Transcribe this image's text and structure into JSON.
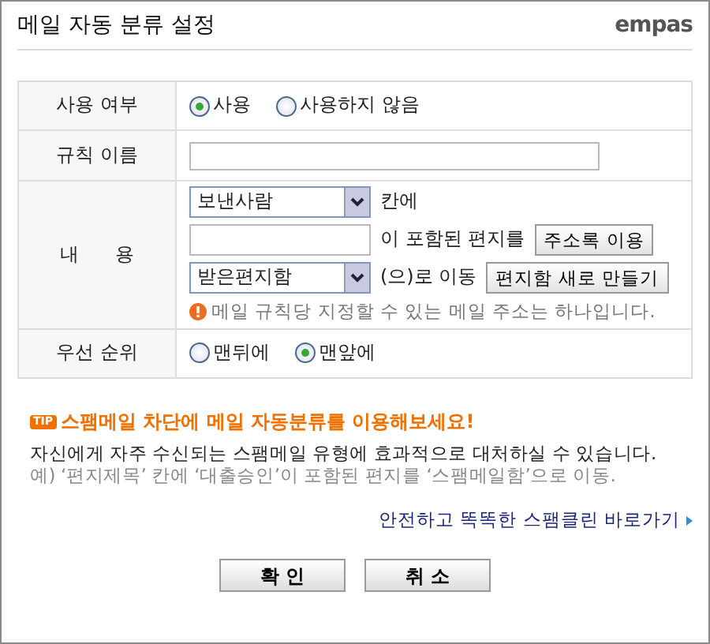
{
  "title": "메일 자동 분류 설정",
  "logo": "empas",
  "use_row": {
    "label": "사용 여부",
    "options": [
      {
        "label": "사용",
        "selected": true
      },
      {
        "label": "사용하지 않음",
        "selected": false
      }
    ]
  },
  "name_row": {
    "label": "규칙 이름"
  },
  "content_row": {
    "label": "내      용",
    "field_select": "보낸사람",
    "field_suffix": "칸에",
    "keyword_suffix": "이 포함된 편지를",
    "address_button": "주소록 이용",
    "folder_select": "받은편지함",
    "folder_suffix": "(으)로 이동",
    "new_folder_button": "편지함 새로 만들기",
    "notice": "메일 규칙당 지정할 수 있는 메일 주소는 하나입니다."
  },
  "priority_row": {
    "label": "우선 순위",
    "options": [
      {
        "label": "맨뒤에",
        "selected": false
      },
      {
        "label": "맨앞에",
        "selected": true
      }
    ]
  },
  "tip": {
    "badge": "TIP",
    "heading": "스팸메일 차단에 메일 자동분류를 이용해보세요!",
    "text": "자신에게 자주 수신되는 스팸메일 유형에 효과적으로 대처하실 수 있습니다.",
    "example": "예) ‘편지제목’ 칸에 ‘대출승인’이 포함된 편지를 ‘스팸메일함’으로 이동."
  },
  "link": "안전하고 똑똑한 스팸클린 바로가기",
  "buttons": [
    "확 인",
    "취 소"
  ]
}
